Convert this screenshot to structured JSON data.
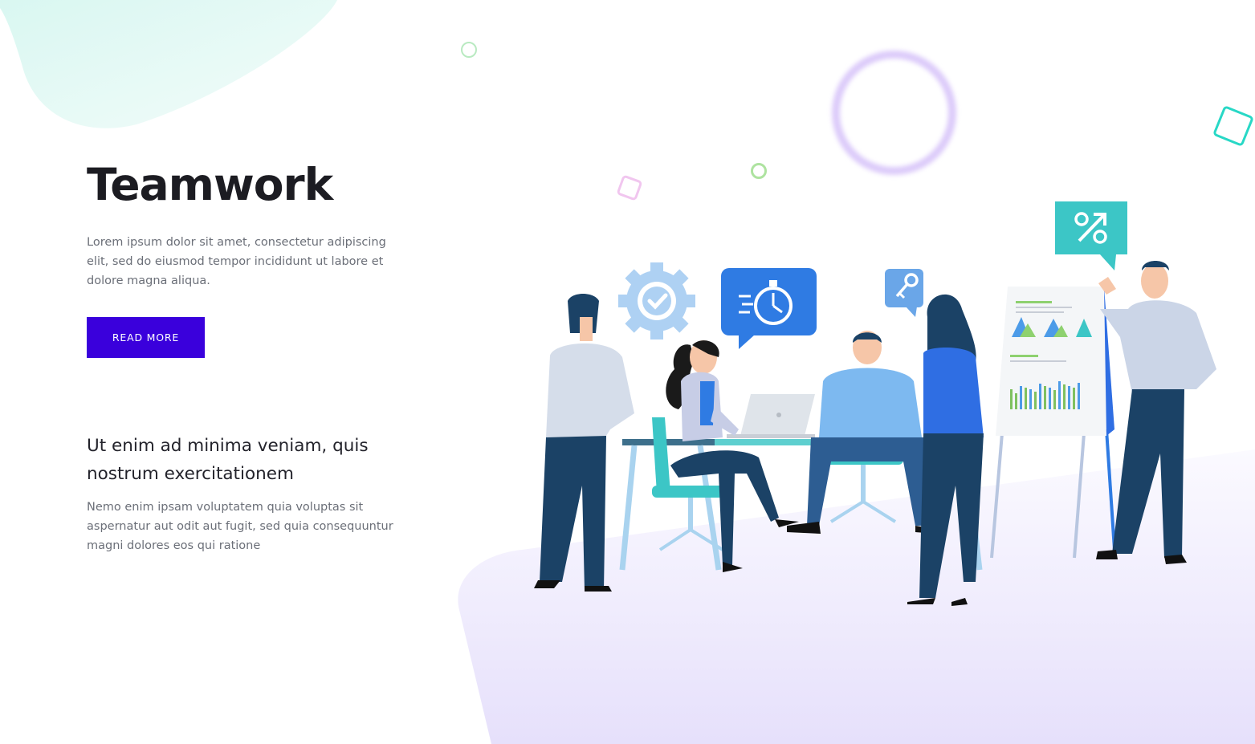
{
  "hero": {
    "title": "Teamwork",
    "text": "Lorem ipsum dolor sit amet, consectetur adipiscing elit, sed do eiusmod tempor incididunt ut labore et dolore magna aliqua.",
    "button_label": "READ MORE"
  },
  "feature": {
    "title": "Ut enim ad minima veniam, quis nostrum exercitationem",
    "text": "Nemo enim ipsam voluptatem quia voluptas sit aspernatur aut odit aut fugit, sed quia consequuntur magni dolores eos qui ratione"
  },
  "illustration": {
    "icons": [
      "gear-check-icon",
      "stopwatch-icon",
      "key-icon",
      "percent-icon"
    ]
  },
  "colors": {
    "accent": "#3a00dc",
    "heading": "#1c1c22",
    "body_text": "#6b6f78",
    "teal": "#3cc6c6",
    "speech_blue": "#2f7be3",
    "navy": "#1b4266"
  }
}
